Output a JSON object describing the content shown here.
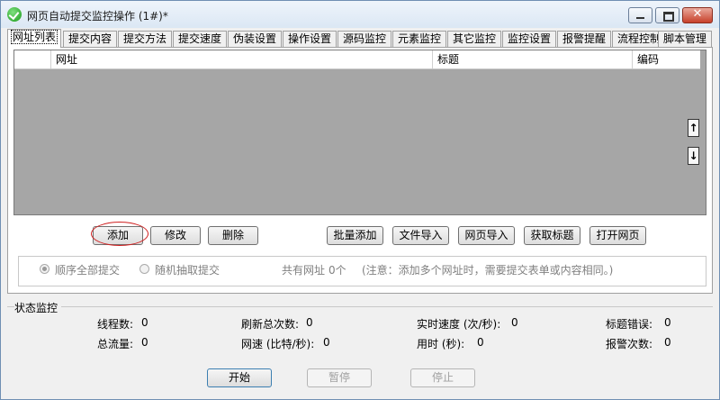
{
  "window": {
    "title": "网页自动提交监控操作 (1#)*",
    "close_glyph": "✕"
  },
  "tabs": [
    "网址列表",
    "提交内容",
    "提交方法",
    "提交速度",
    "伪装设置",
    "操作设置",
    "源码监控",
    "元素监控",
    "其它监控",
    "监控设置",
    "报警提醒",
    "流程控制",
    "脚本管理"
  ],
  "table": {
    "columns": [
      "网址",
      "标题",
      "编码"
    ],
    "rows": []
  },
  "scroll": {
    "up": "↑",
    "down": "↓"
  },
  "url_buttons": {
    "add": "添加",
    "edit": "修改",
    "delete": "删除",
    "batch_add": "批量添加",
    "import_file": "文件导入",
    "import_page": "网页导入",
    "get_title": "获取标题",
    "open_page": "打开网页"
  },
  "options": {
    "sequential": "顺序全部提交",
    "random": "随机抽取提交",
    "count_label": "共有网址",
    "count_value": "0个",
    "note": "(注意：添加多个网址时，需要提交表单或内容相同。)",
    "selected": "sequential"
  },
  "status": {
    "title": "状态监控",
    "threads": {
      "label": "线程数:",
      "value": "0"
    },
    "refresh_total": {
      "label": "刷新总次数:",
      "value": "0"
    },
    "realtime_speed": {
      "label": "实时速度 (次/秒):",
      "value": "0"
    },
    "title_errors": {
      "label": "标题错误:",
      "value": "0"
    },
    "total_traffic": {
      "label": "总流量:",
      "value": "0"
    },
    "net_speed": {
      "label": "网速 (比特/秒):",
      "value": "0"
    },
    "elapsed": {
      "label": "用时 (秒):",
      "value": "0"
    },
    "alarm_count": {
      "label": "报警次数:",
      "value": "0"
    }
  },
  "controls": {
    "start": "开始",
    "pause": "暂停",
    "stop": "停止"
  }
}
